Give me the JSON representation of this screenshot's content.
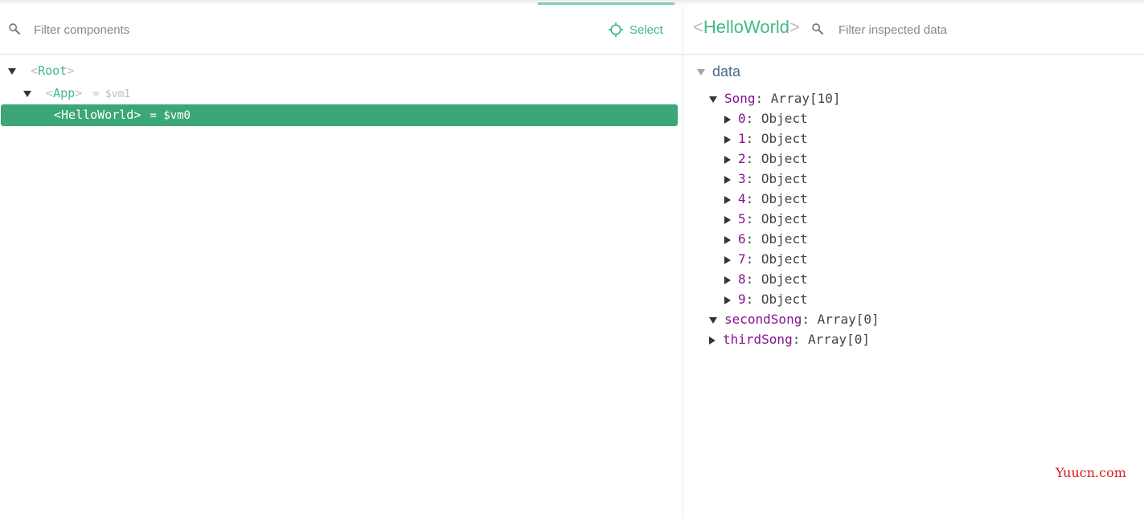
{
  "components_pane": {
    "filter_placeholder": "Filter components",
    "select_label": "Select",
    "tree": {
      "root": {
        "name": "Root"
      },
      "app": {
        "name": "App",
        "vm": "= $vm1"
      },
      "hello": {
        "name": "HelloWorld",
        "vm": "= $vm0"
      }
    }
  },
  "inspector_pane": {
    "component_name": "HelloWorld",
    "filter_placeholder": "Filter inspected data",
    "section_title": "data",
    "song": {
      "key": "Song",
      "value": "Array[10]"
    },
    "items": [
      {
        "index": "0",
        "value": "Object"
      },
      {
        "index": "1",
        "value": "Object"
      },
      {
        "index": "2",
        "value": "Object"
      },
      {
        "index": "3",
        "value": "Object"
      },
      {
        "index": "4",
        "value": "Object"
      },
      {
        "index": "5",
        "value": "Object"
      },
      {
        "index": "6",
        "value": "Object"
      },
      {
        "index": "7",
        "value": "Object"
      },
      {
        "index": "8",
        "value": "Object"
      },
      {
        "index": "9",
        "value": "Object"
      }
    ],
    "second_song": {
      "key": "secondSong",
      "value": "Array[0]"
    },
    "third_song": {
      "key": "thirdSong",
      "value": "Array[0]"
    }
  },
  "watermark": "Yuucn.com",
  "icons": [
    "search-icon",
    "crosshair-icon",
    "triangle-down-icon",
    "triangle-right-icon"
  ],
  "colors": {
    "accent": "#42b983",
    "selected_row": "#3ba776",
    "key": "#881391",
    "watermark": "#e0151b"
  }
}
